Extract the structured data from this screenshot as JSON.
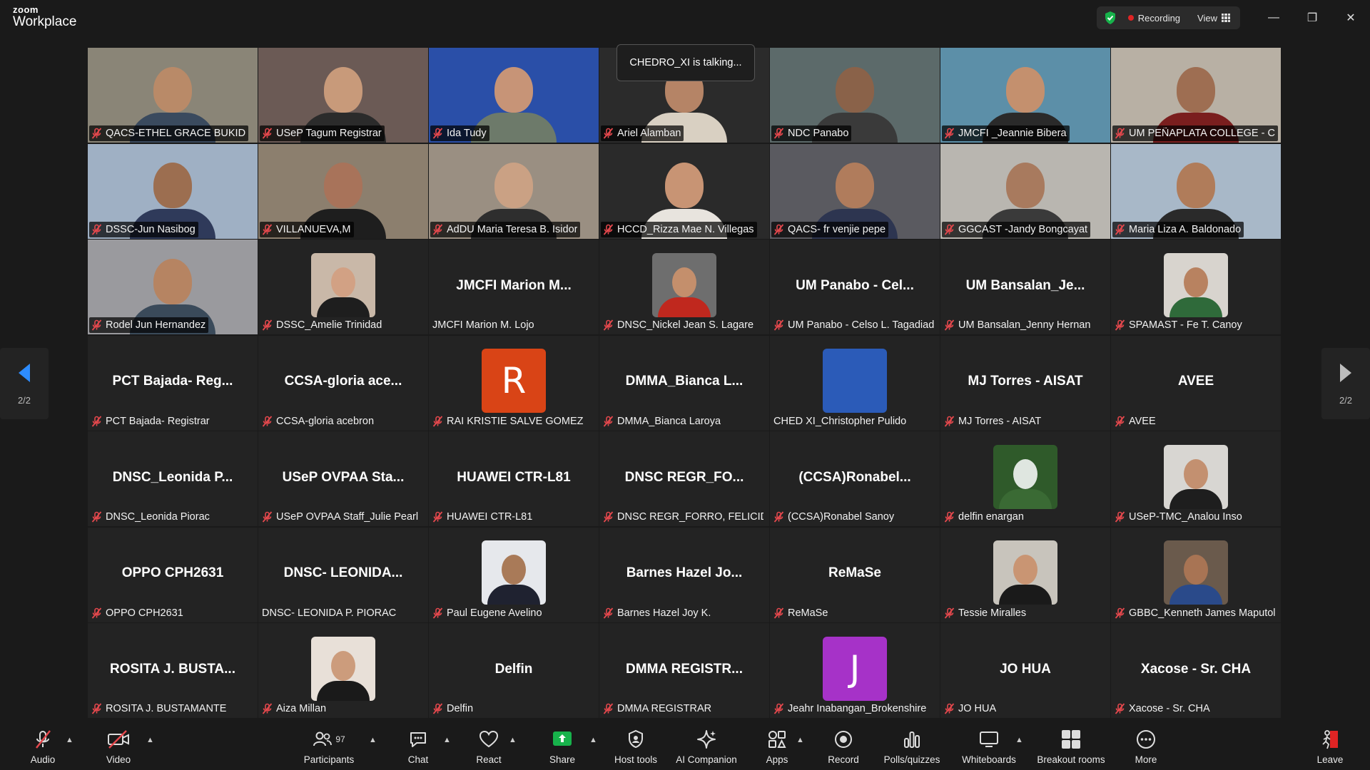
{
  "app": {
    "logo_top": "zoom",
    "logo_bottom": "Workplace"
  },
  "titlebar": {
    "recording_label": "Recording",
    "view_label": "View",
    "minimize_glyph": "—",
    "restore_glyph": "❐",
    "close_glyph": "✕"
  },
  "talking_banner": "CHEDRO_XI is talking...",
  "pager": {
    "left_label": "2/2",
    "right_label": "2/2"
  },
  "tiles": [
    {
      "type": "video",
      "name": "QACS-ETHEL GRACE BUKID",
      "muted": true,
      "bg": "#8a8577",
      "face": "#b98a68",
      "body": "#3a4a5e"
    },
    {
      "type": "video",
      "name": "USeP Tagum Registrar",
      "muted": true,
      "bg": "#6b5a55",
      "face": "#c89a7a",
      "body": "#2b2b2b"
    },
    {
      "type": "video",
      "name": "Ida Tudy",
      "muted": true,
      "bg": "#2a4fa8",
      "face": "#c79477",
      "body": "#6d7a6a"
    },
    {
      "type": "video",
      "name": "Ariel Alamban",
      "muted": true,
      "bg": "#2b2b2b",
      "face": "#b58466",
      "body": "#d9d0c2"
    },
    {
      "type": "video",
      "name": "NDC Panabo",
      "muted": true,
      "bg": "#5c6a6a",
      "face": "#8a6249",
      "body": "#3a3a3a"
    },
    {
      "type": "video",
      "name": "JMCFI _Jeannie Bibera",
      "muted": true,
      "bg": "#5c8fa8",
      "face": "#c4906e",
      "body": "#2a2a2a"
    },
    {
      "type": "video",
      "name": "UM PEÑAPLATA COLLEGE - C...",
      "muted": true,
      "bg": "#b8b0a4",
      "face": "#9e6e52",
      "body": "#7a1e1e"
    },
    {
      "type": "video",
      "name": "DSSC-Jun Nasibog",
      "muted": true,
      "bg": "#9fb0c4",
      "face": "#9c6e50",
      "body": "#2f3a5a"
    },
    {
      "type": "video",
      "name": "VILLANUEVA,M",
      "muted": true,
      "bg": "#8c7f6e",
      "face": "#a8735a",
      "body": "#1e1e1e"
    },
    {
      "type": "video",
      "name": "AdDU Maria Teresa B. Isidor",
      "muted": true,
      "bg": "#9a8f82",
      "face": "#caa184",
      "body": "#2e2e2e"
    },
    {
      "type": "video",
      "name": "HCCD_Rizza Mae N. Villegas",
      "muted": true,
      "bg": "#2a2a2a",
      "face": "#c89474",
      "body": "#e8e4de"
    },
    {
      "type": "video",
      "name": "QACS- fr venjie pepe",
      "muted": true,
      "bg": "#5a5a60",
      "face": "#b07c5c",
      "body": "#2d3550"
    },
    {
      "type": "video",
      "name": "GGCAST -Jandy Bongcayat",
      "muted": true,
      "bg": "#b9b6b0",
      "face": "#a87a5e",
      "body": "#3a3a3a"
    },
    {
      "type": "video",
      "name": "Maria Liza A. Baldonado",
      "muted": true,
      "bg": "#a8b8c8",
      "face": "#b07c5a",
      "body": "#2a2a2a"
    },
    {
      "type": "video",
      "name": "Rodel Jun Hernandez",
      "muted": true,
      "bg": "#9a9a9e",
      "face": "#b68462",
      "body": "#3a4a5a"
    },
    {
      "type": "photo",
      "name": "DSSC_Amelie Trinidad",
      "muted": true,
      "bg": "#c9b8a8",
      "face": "#d2a184",
      "body": "#1e1e1e"
    },
    {
      "type": "text",
      "display": "JMCFI Marion M...",
      "name": "JMCFI Marion M. Lojo",
      "muted": false
    },
    {
      "type": "photo",
      "name": "DNSC_Nickel Jean S. Lagare",
      "muted": true,
      "bg": "#6e6e6e",
      "face": "#c48f6c",
      "body": "#c0281e"
    },
    {
      "type": "text",
      "display": "UM Panabo - Cel...",
      "name": "UM Panabo - Celso L. Tagadiad",
      "muted": true
    },
    {
      "type": "text",
      "display": "UM  Bansalan_Je...",
      "name": "UM Bansalan_Jenny Hernan",
      "muted": true
    },
    {
      "type": "photo",
      "name": "SPAMAST - Fe T. Canoy",
      "muted": true,
      "bg": "#d8d4ce",
      "face": "#b88260",
      "body": "#2f6a3a"
    },
    {
      "type": "text",
      "display": "PCT Bajada- Reg...",
      "name": "PCT Bajada- Registrar",
      "muted": true
    },
    {
      "type": "text",
      "display": "CCSA-gloria ace...",
      "name": "CCSA-gloria acebron",
      "muted": true
    },
    {
      "type": "letter",
      "letter": "R",
      "color": "#d94416",
      "name": "RAI KRISTIE SALVE GOMEZ",
      "muted": true
    },
    {
      "type": "text",
      "display": "DMMA_Bianca L...",
      "name": "DMMA_Bianca Laroya",
      "muted": true
    },
    {
      "type": "letter",
      "letter": "",
      "color": "#2b5bb8",
      "name": "CHED XI_Christopher Pulido",
      "muted": false
    },
    {
      "type": "text",
      "display": "MJ Torres - AISAT",
      "name": "MJ Torres - AISAT",
      "muted": true
    },
    {
      "type": "text",
      "display": "AVEE",
      "name": "AVEE",
      "muted": true
    },
    {
      "type": "text",
      "display": "DNSC_Leonida P...",
      "name": "DNSC_Leonida Piorac",
      "muted": true
    },
    {
      "type": "text",
      "display": "USeP OVPAA Sta...",
      "name": "USeP OVPAA Staff_Julie Pearl",
      "muted": true
    },
    {
      "type": "text",
      "display": "HUAWEI CTR-L81",
      "name": "HUAWEI CTR-L81",
      "muted": true
    },
    {
      "type": "text",
      "display": "DNSC  REGR_FO...",
      "name": "DNSC REGR_FORRO, FELICIDA...",
      "muted": true
    },
    {
      "type": "text",
      "display": "(CCSA)Ronabel...",
      "name": "(CCSA)Ronabel Sanoy",
      "muted": true
    },
    {
      "type": "photo",
      "name": "delfin enargan",
      "muted": true,
      "bg": "#2f5a2a",
      "face": "#dfe6e0",
      "body": "#3a6a34"
    },
    {
      "type": "photo",
      "name": "USeP-TMC_Analou Inso",
      "muted": true,
      "bg": "#d8d6d2",
      "face": "#c39070",
      "body": "#1e1e1e"
    },
    {
      "type": "text",
      "display": "OPPO CPH2631",
      "name": "OPPO CPH2631",
      "muted": true
    },
    {
      "type": "text",
      "display": "DNSC- LEONIDA...",
      "name": "DNSC- LEONIDA P. PIORAC",
      "muted": false
    },
    {
      "type": "photo",
      "name": "Paul Eugene Avelino",
      "muted": true,
      "bg": "#e6e8ec",
      "face": "#a97a58",
      "body": "#1f2230"
    },
    {
      "type": "text",
      "display": "Barnes Hazel Jo...",
      "name": "Barnes Hazel Joy K.",
      "muted": true
    },
    {
      "type": "text",
      "display": "ReMaSe",
      "name": "ReMaSe",
      "muted": true
    },
    {
      "type": "photo",
      "name": "Tessie Miralles",
      "muted": true,
      "bg": "#c8c4bc",
      "face": "#c99573",
      "body": "#1a1a1a"
    },
    {
      "type": "photo",
      "name": "GBBC_Kenneth James Maputol",
      "muted": true,
      "bg": "#6a5a4c",
      "face": "#a87454",
      "body": "#2a4a8a"
    },
    {
      "type": "text",
      "display": "ROSITA J. BUSTA...",
      "name": "ROSITA J. BUSTAMANTE",
      "muted": true
    },
    {
      "type": "photo",
      "name": "Aiza Millan",
      "muted": true,
      "bg": "#e8e0d8",
      "face": "#cc9c7c",
      "body": "#1a1a1a"
    },
    {
      "type": "text",
      "display": "Delfin",
      "name": "Delfin",
      "muted": true
    },
    {
      "type": "text",
      "display": "DMMA  REGISTR...",
      "name": "DMMA REGISTRAR",
      "muted": true
    },
    {
      "type": "letter",
      "letter": "J",
      "color": "#a632c8",
      "name": "Jeahr Inabangan_Brokenshire",
      "muted": true
    },
    {
      "type": "text",
      "display": "JO HUA",
      "name": "JO HUA",
      "muted": true
    },
    {
      "type": "text",
      "display": "Xacose - Sr. CHA",
      "name": "Xacose - Sr. CHA",
      "muted": true
    }
  ],
  "toolbar": {
    "audio": "Audio",
    "video": "Video",
    "participants": "Participants",
    "participants_count": "97",
    "chat": "Chat",
    "react": "React",
    "share": "Share",
    "host_tools": "Host tools",
    "ai_companion": "AI Companion",
    "apps": "Apps",
    "record": "Record",
    "polls": "Polls/quizzes",
    "whiteboards": "Whiteboards",
    "breakout": "Breakout rooms",
    "more": "More",
    "leave": "Leave"
  },
  "colors": {
    "share_green": "#17b24b",
    "leave_red": "#e02424",
    "muted_red": "#e5484d",
    "pager_arrow_blue": "#2d8cff"
  }
}
